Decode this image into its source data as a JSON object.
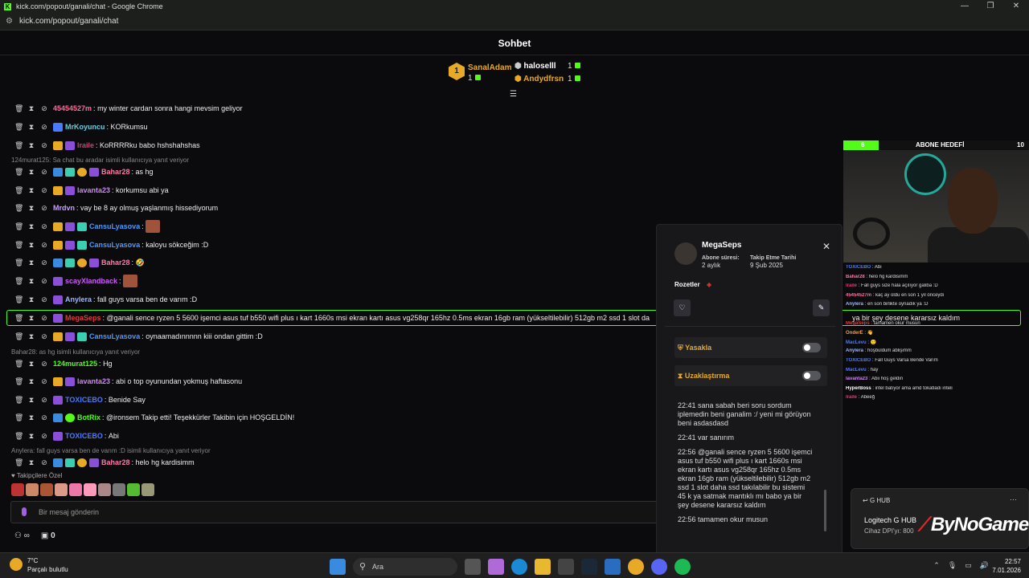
{
  "window": {
    "title": "kick.com/popout/ganali/chat - Google Chrome",
    "url": "kick.com/popout/ganali/chat",
    "controls": [
      "—",
      "❐",
      "✕"
    ]
  },
  "header": {
    "title": "Sohbet"
  },
  "leaderboard": {
    "top": {
      "rank": "1",
      "name": "SanalAdam",
      "count": "1"
    },
    "others": [
      {
        "name": "haloselll",
        "count": "1"
      },
      {
        "name": "Andydfrsn",
        "count": "1"
      }
    ]
  },
  "chat": {
    "messages": [
      {
        "user": "45454527m",
        "color": "#ff6b9a",
        "text": "my winter cardan sonra hangi mevsim geliyor"
      },
      {
        "user": "MrKoyuncu",
        "color": "#5fd0e8",
        "text": "KORkumsu"
      },
      {
        "user": "lraile",
        "color": "#d04070",
        "text": "KoRRRRku babo hshshahshas"
      },
      {
        "reply": "124murat125: Sa chat bu aradar isimli kullanıcıya yanıt veriyor"
      },
      {
        "user": "Bahar28",
        "color": "#ff77aa",
        "text": "as hg"
      },
      {
        "user": "lavanta23",
        "color": "#cc88ee",
        "text": "korkumsu abi ya"
      },
      {
        "user": "Mrdvn",
        "color": "#c9a0ff",
        "text": "vay be 8 ay olmuş yaşlanmış hissediyorum"
      },
      {
        "user": "CansuLyasova",
        "color": "#4a9aff",
        "text": ""
      },
      {
        "user": "CansuLyasova",
        "color": "#4a9aff",
        "text": "kaloyu sökceğim :D"
      },
      {
        "user": "Bahar28",
        "color": "#ff77aa",
        "text": "🤣"
      },
      {
        "user": "scayXlandback",
        "color": "#d058ff",
        "text": ""
      },
      {
        "user": "Anylera",
        "color": "#9ab8ff",
        "text": "fall guys varsa ben de varım :D"
      },
      {
        "user": "MegaSeps",
        "color": "#e03a3a",
        "text": "@ganali sence ryzen 5 5600 işemci asus tuf b550 wifi plus ı kart 1660s msi ekran kartı asus vg258qr 165hz 0.5ms ekran 16gb ram (yükseltilebilir) 512gb m2 ssd 1 slot da"
      },
      {
        "user": "CansuLyasova",
        "color": "#4a9aff",
        "text": "oynaamadınnnnn kiii ondan gittim :D"
      },
      {
        "reply": "Bahar28: as hg isimli kullanıcıya yanıt veriyor"
      },
      {
        "user": "124murat125",
        "color": "#53fc18",
        "text": "Hg"
      },
      {
        "user": "lavanta23",
        "color": "#cc88ee",
        "text": "abi o top oyunundan yokmuş haftasonu"
      },
      {
        "user": "TOXICEBO",
        "color": "#4a7aff",
        "text": "Benide Say"
      },
      {
        "user": "BotRix",
        "color": "#53fc18",
        "text": "@ironsem Takip etti! Teşekkürler Takibin için HOŞGELDİN!"
      },
      {
        "user": "TOXICEBO",
        "color": "#4a7aff",
        "text": "Abi"
      },
      {
        "reply": "Anylera: fall guys varsa ben de varım :D isimli kullanıcıya yanıt veriyor"
      },
      {
        "user": "Bahar28",
        "color": "#ff77aa",
        "text": "helo hg kardisimm"
      }
    ],
    "followers_label": "Takipçilere Özel",
    "input_placeholder": "Bir mesaj gönderin",
    "bottom_count": "0"
  },
  "user_card": {
    "name": "MegaSeps",
    "sub_label": "Abone süresi:",
    "sub_value": "2 aylık",
    "follow_label": "Takip Etme Tarihi",
    "follow_value": "9 Şub 2025",
    "badges_label": "Rozetler",
    "ban_label": "Yasakla",
    "timeout_label": "Uzaklaştırma",
    "history": [
      "22:41 sana sabah beri soru sordum iplemedin beni ganalim :/ yeni mi görüyon beni asdasdasd",
      "22:41 var sanırım",
      "22:56 @ganali sence ryzen 5 5600 işemci asus tuf b550 wifi plus ı kart 1660s msi ekran kartı asus vg258qr 165hz 0.5ms ekran 16gb ram (yükseltilebilir) 512gb m2 ssd 1 slot daha ssd takılabilir bu sistemi 45 k ya satmak mantıklı mı babo ya bir şey desene kararsız kaldım",
      "22:56 tamamen okur musun"
    ]
  },
  "stream_overlay": {
    "goal_left": "6",
    "goal_label": "ABONE HEDEFİ",
    "goal_right": "10",
    "highlight_tail": "ya bir şey desene kararsız kaldım",
    "mini_chat": [
      {
        "user": "TOXICEBO",
        "text": "Abi"
      },
      {
        "user": "Bahar28",
        "text": "helo hg kardisimm"
      },
      {
        "user": "lraile",
        "text": "Fall guys size hala açılıyor galiba :D"
      },
      {
        "user": "45454527m",
        "text": "kaç ay oldu en son 1 yıl önceydi"
      },
      {
        "user": "Anylera",
        "text": "en son birlikte oynadık ya :D"
      },
      {
        "user": "",
        "text": ""
      },
      {
        "user": "MegaSeps",
        "text": "tamamen okur musun"
      },
      {
        "user": "OnderE",
        "text": "👋"
      },
      {
        "user": "MacLevu",
        "text": "🙂"
      },
      {
        "user": "Anylera",
        "text": "hoşbuldum ablişimm"
      },
      {
        "user": "TOXICEBO",
        "text": "Fall Guys Varsa Bende Varım"
      },
      {
        "user": "MacLevu",
        "text": "hay"
      },
      {
        "user": "lavanta23",
        "text": "Abii hoş geldin"
      },
      {
        "user": "HyperBoss",
        "text": "intel batıyor ama amd tokatladı inteli"
      },
      {
        "user": "lraile",
        "text": "Abeeğ"
      }
    ],
    "notif_title": "G HUB",
    "notif_main": "Logitech G HUB",
    "notif_sub": "Cihaz DPI'yı: 800",
    "watermark": "ByNoGame"
  },
  "taskbar": {
    "temp": "7°C",
    "weather": "Parçalı bulutlu",
    "search": "Ara",
    "time": "22:57",
    "date": "7.01.2026"
  }
}
